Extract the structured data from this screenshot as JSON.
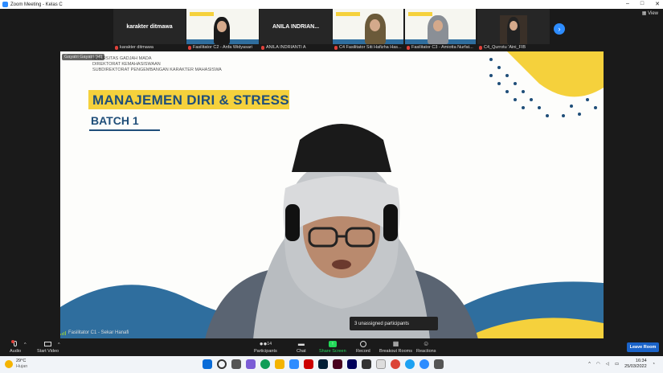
{
  "window": {
    "title": "Zoom Meeting - Kelas C",
    "controls": [
      "–",
      "□",
      "✕"
    ]
  },
  "strip": {
    "view_label": "View",
    "thumbnails": [
      {
        "display": "karakter ditmawa",
        "name": "karakter ditmawa",
        "muted": true
      },
      {
        "display": "",
        "name": "Fasilitator C2 - Anfa Widyasari",
        "muted": true
      },
      {
        "display": "ANILA INDRIAN...",
        "name": "ANILA INDRIANTI A",
        "muted": true
      },
      {
        "display": "",
        "name": "C4 Fasilitator Siti Hafizha Has...",
        "muted": true
      },
      {
        "display": "",
        "name": "Fasilitator C3 - Amiotta Nurfat...",
        "muted": true
      },
      {
        "display": "",
        "name": "C4_Qurrotu 'Aini_FIB",
        "muted": true
      }
    ]
  },
  "stage": {
    "speaker_tag": "Gayatri Gayatri (Hl)",
    "header_lines": [
      "NIVERSITAS GADJAH MADA",
      "DIREKTORAT KEMAHASISWAAN",
      "SUBDIREKTORAT PENGEMBANGAN KARAKTER MAHASISWA"
    ],
    "title": "MANAJEMEN DIRI & STRESS",
    "subtitle": "BATCH 1",
    "speaker_name": "Fasilitator C1 - Sekar Hanafi",
    "unassigned_popup": "3 unassigned participants",
    "colors": {
      "accent_yellow": "#f5d13c",
      "navy": "#1f4e79",
      "wave_blue": "#2f6e9e"
    }
  },
  "toolbar": {
    "audio": "Audio",
    "video": "Start Video",
    "participants": "Participants",
    "participants_count": "14",
    "chat": "Chat",
    "share": "Share Screen",
    "record": "Record",
    "breakout": "Breakout Rooms",
    "reactions": "Reactions",
    "leave": "Leave Room"
  },
  "taskbar": {
    "temperature": "29°C",
    "weather": "Hujan",
    "time": "16:34",
    "date": "25/03/2022"
  }
}
